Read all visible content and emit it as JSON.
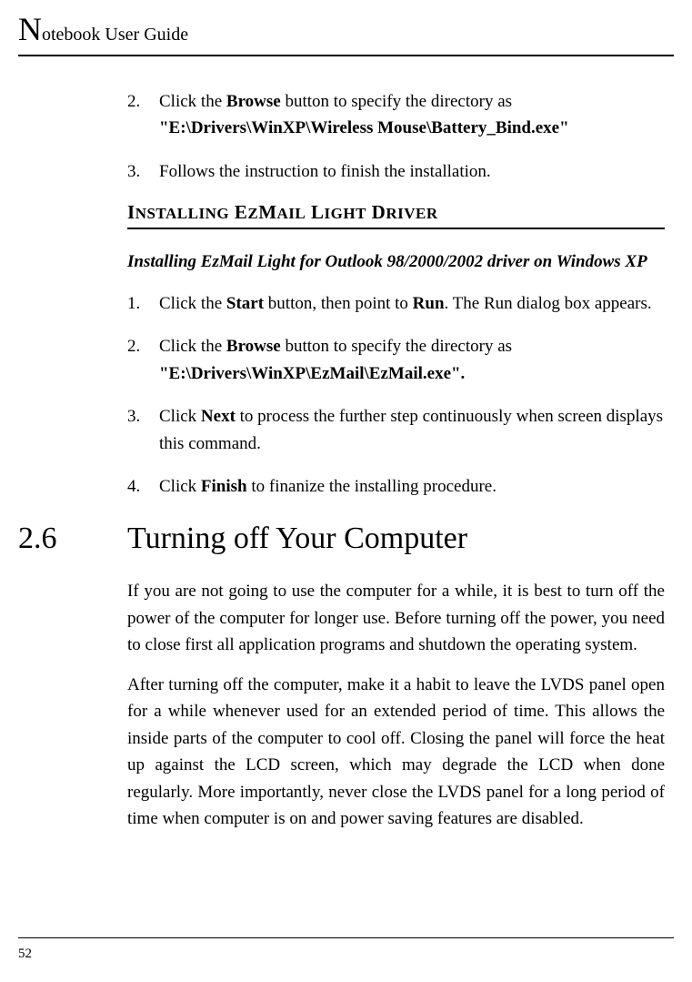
{
  "header": {
    "dropcap": "N",
    "title_rest": "otebook User Guide"
  },
  "top_list": [
    {
      "num": "2.",
      "pre": "Click the ",
      "bold1": "Browse",
      "mid": " button to specify the directory as ",
      "bold2": "\"E:\\Drivers\\WinXP\\Wireless Mouse\\Battery_Bind.exe\""
    },
    {
      "num": "3.",
      "text": "Follows the instruction to finish the installation."
    }
  ],
  "section_heading": "INSTALLING EZMAIL LIGHT DRIVER",
  "sub_heading": "Installing EzMail Light for Outlook 98/2000/2002 driver on Windows XP",
  "ez_list": [
    {
      "num": "1.",
      "pre": "Click the ",
      "bold1": "Start",
      "mid": " button, then point to ",
      "bold2": "Run",
      "post": ". The Run dialog box appears."
    },
    {
      "num": "2.",
      "pre": "Click the ",
      "bold1": "Browse",
      "mid": " button to specify the directory as ",
      "bold2": "\"E:\\Drivers\\WinXP\\EzMail\\EzMail.exe\"."
    },
    {
      "num": "3.",
      "pre": "Click ",
      "bold1": "Next",
      "post": " to process the further step continuously when screen displays this command."
    },
    {
      "num": "4.",
      "pre": "Click ",
      "bold1": "Finish",
      "post": " to finanize the installing procedure."
    }
  ],
  "chapter": {
    "num": "2.6",
    "title": "Turning off Your Computer"
  },
  "paragraphs": [
    "If you are not going to use the computer for a while, it is best to turn off the power of the computer for longer use. Before turning off the power, you need to close first all application programs and shutdown the operating system.",
    "After turning off the computer, make it a habit to leave the LVDS panel open for a while whenever used for an extended period of time. This allows the inside parts of the computer to cool off. Closing the panel will force the heat up against the LCD screen, which may degrade the LCD when done regularly. More importantly, never close the LVDS panel for a long period of time when computer is on and power saving features are disabled."
  ],
  "page_number": "52"
}
